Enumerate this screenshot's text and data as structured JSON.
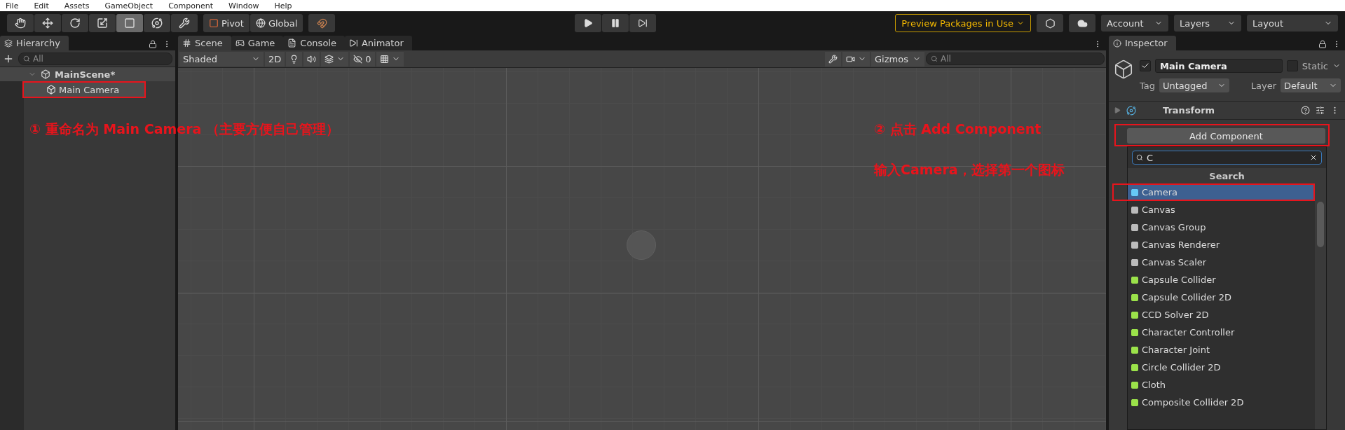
{
  "menu": [
    "File",
    "Edit",
    "Assets",
    "GameObject",
    "Component",
    "Window",
    "Help"
  ],
  "toolbar": {
    "tools": [
      {
        "selected": false
      },
      {
        "selected": false
      },
      {
        "selected": false
      },
      {
        "selected": false
      },
      {
        "selected": true
      },
      {
        "selected": false
      },
      {
        "selected": false
      }
    ],
    "pivot": "Pivot",
    "global": "Global",
    "preview": "Preview Packages in Use",
    "account": "Account",
    "layers": "Layers",
    "layout": "Layout"
  },
  "hierarchy": {
    "title": "Hierarchy",
    "search_placeholder": "All",
    "scene": {
      "name": "MainScene*",
      "expanded": true,
      "children": [
        {
          "name": "Main Camera",
          "selected": true
        }
      ]
    }
  },
  "scene_tabs": [
    {
      "label": "Scene",
      "selected": true
    },
    {
      "label": "Game",
      "selected": false
    },
    {
      "label": "Console",
      "selected": false
    },
    {
      "label": "Animator",
      "selected": false
    }
  ],
  "scene_toolbar": {
    "shading": "Shaded",
    "mode": "2D",
    "hidden_count": "0",
    "gizmos": "Gizmos",
    "search_placeholder": "All"
  },
  "inspector": {
    "title": "Inspector",
    "object": {
      "name": "Main Camera",
      "active": true,
      "static": false,
      "static_label": "Static",
      "tag_label": "Tag",
      "tag": "Untagged",
      "layer_label": "Layer",
      "layer": "Default"
    },
    "component": "Transform",
    "add_button": "Add Component",
    "search_value": "C",
    "results_header": "Search",
    "results": [
      {
        "label": "Camera",
        "selected": true
      },
      {
        "label": "Canvas",
        "selected": false
      },
      {
        "label": "Canvas Group",
        "selected": false
      },
      {
        "label": "Canvas Renderer",
        "selected": false
      },
      {
        "label": "Canvas Scaler",
        "selected": false
      },
      {
        "label": "Capsule Collider",
        "selected": false
      },
      {
        "label": "Capsule Collider 2D",
        "selected": false
      },
      {
        "label": "CCD Solver 2D",
        "selected": false
      },
      {
        "label": "Character Controller",
        "selected": false
      },
      {
        "label": "Character Joint",
        "selected": false
      },
      {
        "label": "Circle Collider 2D",
        "selected": false
      },
      {
        "label": "Cloth",
        "selected": false
      },
      {
        "label": "Composite Collider 2D",
        "selected": false
      }
    ]
  },
  "annotations": [
    {
      "text": "① 重命名为 Main Camera （主要方便自己管理）"
    },
    {
      "text": "② 点击 Add Component"
    },
    {
      "text": "输入Camera，选择第一个图标"
    }
  ]
}
